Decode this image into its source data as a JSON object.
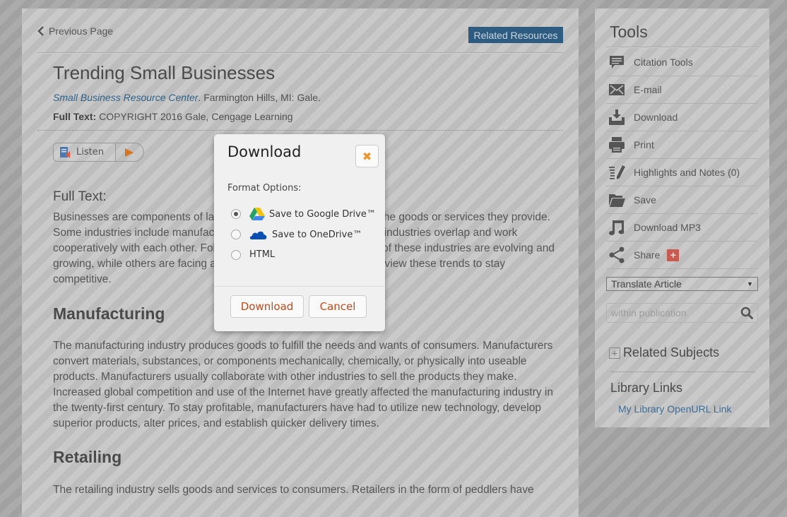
{
  "main": {
    "previous_page": "Previous Page",
    "related_resources": "Related Resources",
    "title": "Trending Small Businesses",
    "source_publication": "Small Business Resource Center",
    "source_rest": ". Farmington Hills, MI: Gale.",
    "copyright_label": "Full Text:",
    "copyright_text": " COPYRIGHT 2016 Gale, Cengage Learning",
    "listen_label": "Listen",
    "fulltext_heading": "Full Text:",
    "intro_paragraph": "Businesses are components of larger industries and are defined by the goods or services they provide. Some industries include manufacturing, retailing, and service. Many industries overlap and work cooperatively with each other. Following trends in the market, some of these industries are evolving and growing, while others are facing a decline. Small businesses must review these trends to stay competitive.",
    "sections": [
      {
        "heading": "Manufacturing",
        "text": "The manufacturing industry produces goods to fulfill the needs and wants of consumers. Manufacturers convert materials, substances, or components mechanically, chemically, or physically into useable products. Manufacturers usually collaborate with other industries to sell the products they make. Increased global competition and use of the Internet have greatly affected the manufacturing industry in the twenty-first century. To stay profitable, manufacturers have had to utilize new technology, develop superior products, alter prices, and establish quicker delivery times."
      },
      {
        "heading": "Retailing",
        "text": "The retailing industry sells goods and services to consumers. Retailers in the form of peddlers have"
      }
    ]
  },
  "sidebar": {
    "title": "Tools",
    "items": [
      {
        "label": "Citation Tools",
        "icon": "citation-icon"
      },
      {
        "label": "E-mail",
        "icon": "email-icon"
      },
      {
        "label": "Download",
        "icon": "download-icon"
      },
      {
        "label": "Print",
        "icon": "print-icon"
      },
      {
        "label": "Highlights and Notes (0)",
        "icon": "highlight-icon"
      },
      {
        "label": "Save",
        "icon": "folder-icon"
      },
      {
        "label": "Download MP3",
        "icon": "music-icon"
      },
      {
        "label": "Share",
        "icon": "share-icon"
      }
    ],
    "translate_selected": "Translate Article",
    "search_placeholder": "within publication",
    "related_subjects": "Related Subjects",
    "library_links_heading": "Library Links",
    "library_link": "My Library OpenURL Link"
  },
  "modal": {
    "title": "Download",
    "format_label": "Format Options:",
    "options": [
      {
        "label": "Save to Google Drive™",
        "selected": true
      },
      {
        "label": "Save to OneDrive™",
        "selected": false
      },
      {
        "label": "HTML",
        "selected": false
      }
    ],
    "download_button": "Download",
    "cancel_button": "Cancel"
  },
  "colors": {
    "accent_button": "#2d5c80",
    "link": "#2e5f86",
    "modal_button_text": "#c04a1a",
    "close_x": "#f0972c",
    "share_plus": "#c95a4f"
  }
}
